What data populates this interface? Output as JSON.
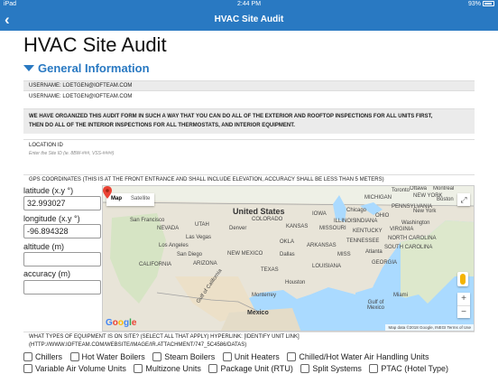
{
  "status_bar": {
    "device": "iPad",
    "time": "2:44 PM",
    "battery": "93%"
  },
  "nav": {
    "back_icon": "chevron-left",
    "title": "HVAC Site Audit"
  },
  "page_title": "HVAC Site Audit",
  "section_title": "General Information",
  "username_1": "USERNAME: LOETGEN@IOFTEAM.COM",
  "username_2": "USERNAME: LOETGEN@IOFTEAM.COM",
  "notice_line_1": "WE HAVE ORGANIZED THIS AUDIT FORM IN SUCH A WAY THAT YOU CAN DO ALL OF THE EXTERIOR AND ROOFTOP INSPECTIONS FOR ALL UNITS FIRST,",
  "notice_line_2": "THEN DO ALL OF THE INTERIOR INSPECTIONS FOR ALL THERMOSTATS, AND INTERIOR EQUIPMENT.",
  "location": {
    "label": "LOCATION ID",
    "placeholder": "Enter the Site ID (ie. 8BW-###, VSS-####)"
  },
  "gps": {
    "label": "GPS COORDINATES (THIS IS AT THE FRONT ENTRANCE AND SHALL INCLUDE ELEVATION, ACCURACY SHALL BE LESS THAN 5 METERS)",
    "latitude_label": "latitude (x.y °)",
    "latitude_value": "32.993027",
    "longitude_label": "longitude (x.y °)",
    "longitude_value": "-96.894328",
    "altitude_label": "altitude (m)",
    "altitude_value": "",
    "accuracy_label": "accuracy (m)",
    "accuracy_value": ""
  },
  "map": {
    "tab_map": "Map",
    "tab_satellite": "Satellite",
    "zoom_in": "+",
    "zoom_out": "−",
    "logo": "Google",
    "attribution": "Map data ©2018 Google, INEGI   Terms of Use",
    "labels": {
      "united_states": "United States",
      "mexico": "Mexico",
      "gulf": "Gulf of\nMexico",
      "dallas": "Dallas",
      "houston": "Houston",
      "chicago": "Chicago",
      "new_york": "New York",
      "washington": "Washington",
      "atlanta": "Atlanta",
      "denver": "Denver",
      "las_vegas": "Las Vegas",
      "los_angeles": "Los Angeles",
      "san_diego": "San Diego",
      "san_francisco": "San Francisco",
      "nevada": "NEVADA",
      "utah": "UTAH",
      "colorado": "COLORADO",
      "kansas": "KANSAS",
      "missouri": "MISSOURI",
      "oklahoma": "OKLA",
      "arkansas": "ARKANSAS",
      "new_mexico": "NEW MEXICO",
      "arizona": "ARIZONA",
      "california": "CALIFORNIA",
      "texas": "TEXAS",
      "tennessee": "TENNESSEE",
      "georgia": "GEORGIA",
      "mississippi": "MISS",
      "louisiana": "LOUISIANA",
      "kentucky": "KENTUCKY",
      "ohio": "OHIO",
      "iowa": "IOWA",
      "michigan": "MICHIGAN",
      "pennsylvania": "PENNSYLVANIA",
      "virginia": "VIRGINIA",
      "north_carolina": "NORTH CAROLINA",
      "south_carolina": "SOUTH CAROLINA",
      "illinois": "ILLINOIS",
      "indiana": "INDIANA",
      "new_york_state": "NEW YORK",
      "miami": "Miami",
      "toronto": "Toronto",
      "montreal": "Montreal",
      "boston": "Boston",
      "ottawa": "Ottawa",
      "monterrey": "Monterrey",
      "gulf_california": "Gulf of California"
    }
  },
  "equipment": {
    "question_line_1": "WHAT TYPES OF EQUIPMENT IS ON SITE? (SELECT ALL THAT APPLY) HYPERLINK: [IDENTIFY UNIT LINK]",
    "question_line_2": "(HTTP://WWW.IOFTEAM.COM/WEBSITE/IMAGE/IR.ATTACHMENT/747_5C4586/DATAS)",
    "options_row1": [
      "Chillers",
      "Hot Water Boilers",
      "Steam Boilers",
      "Unit Heaters",
      "Chilled/Hot Water Air Handling Units"
    ],
    "options_row2": [
      "Variable Air Volume Units",
      "Multizone Units",
      "Package Unit (RTU)",
      "Split Systems",
      "PTAC (Hotel Type)"
    ]
  }
}
